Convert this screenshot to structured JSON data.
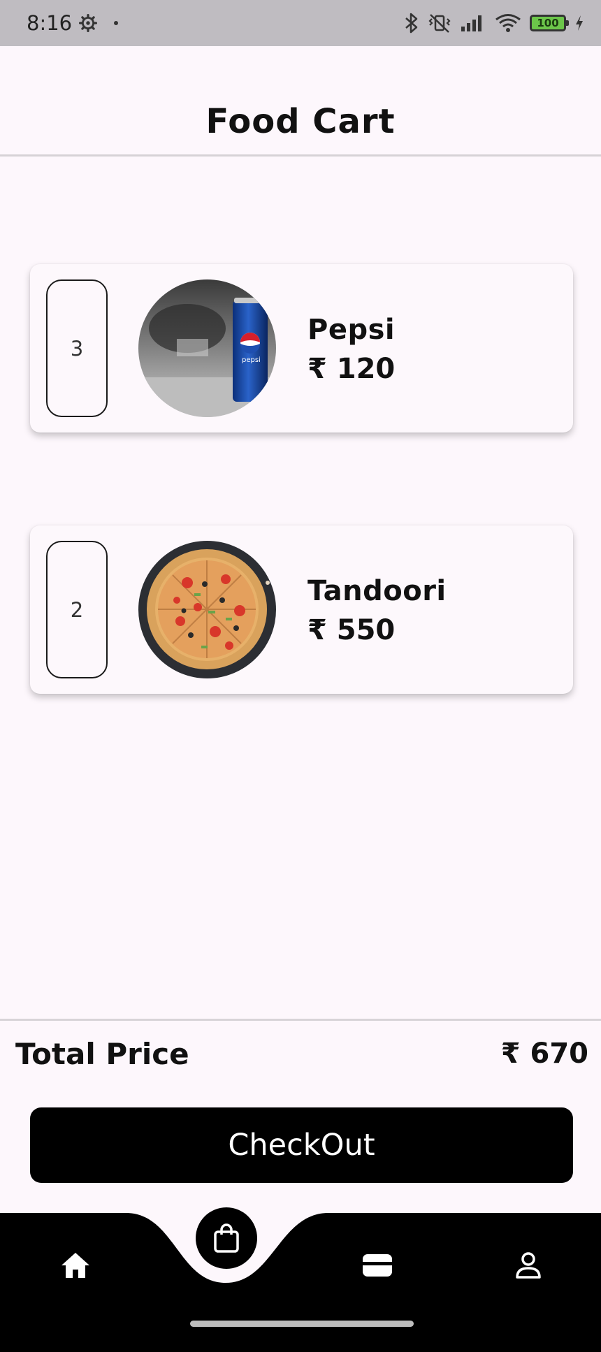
{
  "status_bar": {
    "time": "8:16",
    "battery": "100",
    "icons": [
      "settings-gear-icon",
      "bluetooth-icon",
      "vibrate-off-icon",
      "signal-icon",
      "wifi-icon",
      "battery-icon",
      "charging-icon"
    ]
  },
  "header": {
    "title": "Food Cart"
  },
  "cart": {
    "items": [
      {
        "quantity": "3",
        "name": "Pepsi",
        "price": "₹ 120",
        "image": "pepsi-can-photo"
      },
      {
        "quantity": "2",
        "name": "Tandoori",
        "price": "₹ 550",
        "image": "tandoori-pizza-photo"
      }
    ]
  },
  "summary": {
    "total_label": "Total Price",
    "total_value": "₹ 670"
  },
  "checkout": {
    "label": "CheckOut"
  },
  "bottom_nav": {
    "items": [
      {
        "icon": "home-icon",
        "active": false
      },
      {
        "icon": "shopping-bag-icon",
        "active": true
      },
      {
        "icon": "wallet-icon",
        "active": false
      },
      {
        "icon": "profile-icon",
        "active": false
      }
    ]
  },
  "colors": {
    "background": "#fdf7fc",
    "accent": "#000000",
    "card": "#fdf8fc"
  }
}
